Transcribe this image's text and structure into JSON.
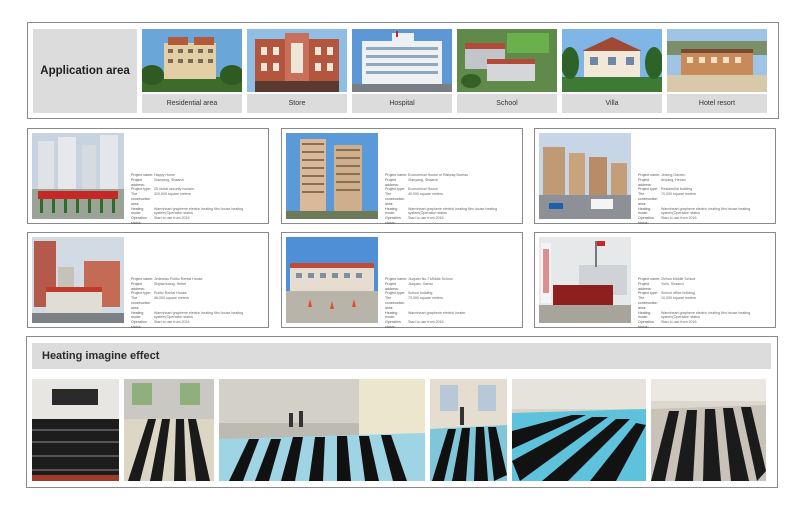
{
  "application": {
    "title": "Application area",
    "areas": [
      {
        "label": "Residential area",
        "icon": "residential-photo"
      },
      {
        "label": "Store",
        "icon": "store-photo"
      },
      {
        "label": "Hospital",
        "icon": "hospital-photo"
      },
      {
        "label": "School",
        "icon": "school-photo"
      },
      {
        "label": "Villa",
        "icon": "villa-photo"
      },
      {
        "label": "Hotel resort",
        "icon": "hotel-resort-photo"
      }
    ]
  },
  "projects": [
    {
      "rows": [
        {
          "k": "Project name:",
          "v": "Happy Home"
        },
        {
          "k": "Project address:",
          "v": "Xianyang, Shaanxi"
        },
        {
          "k": "Project type:",
          "v": "25 rental security houses"
        },
        {
          "k": "The construction area:",
          "v": "320,000 square meters"
        },
        {
          "k": "Heating mode:",
          "v": "Warmheart graphene electric heating film house heating system(Operation status"
        },
        {
          "k": "Operation status:",
          "v": "Start to use from 2015"
        }
      ]
    },
    {
      "rows": [
        {
          "k": "Project name:",
          "v": "Economical House of Railway Bureau"
        },
        {
          "k": "Project address:",
          "v": "Xianyang, Shaanxi"
        },
        {
          "k": "Project type:",
          "v": "Economical House"
        },
        {
          "k": "The construction area:",
          "v": "40,000 square meters"
        },
        {
          "k": "Heating mode:",
          "v": "Warmheart graphene electric heating film house heating system(Operation status"
        },
        {
          "k": "Operation status:",
          "v": "Start to use from 2016"
        }
      ]
    },
    {
      "rows": [
        {
          "k": "Project name:",
          "v": "Jinlong Garden"
        },
        {
          "k": "Project address:",
          "v": "Anyang, Henan"
        },
        {
          "k": "Project type:",
          "v": "Residential building"
        },
        {
          "k": "The construction area:",
          "v": "70,000 square meters"
        },
        {
          "k": "Heating mode:",
          "v": "Warmheart graphene electric heating film house heating system(Operation status"
        },
        {
          "k": "Operation status:",
          "v": "Start to use from 2016"
        }
      ]
    },
    {
      "rows": [
        {
          "k": "Project name:",
          "v": "Jinfeixiao Public Rental House"
        },
        {
          "k": "Project address:",
          "v": "Shijiazhuang, Hebei"
        },
        {
          "k": "Project type:",
          "v": "Public Rental House"
        },
        {
          "k": "The construction area:",
          "v": "46,000 square meters"
        },
        {
          "k": "Heating mode:",
          "v": "Warmheart graphene electric heating film house heating system(Operation status"
        },
        {
          "k": "Operation status:",
          "v": "Start to use from 2014"
        }
      ]
    },
    {
      "rows": [
        {
          "k": "Project name:",
          "v": "Jiuquan No.7 Middle School"
        },
        {
          "k": "Project address:",
          "v": "Jiuquan, Gansu"
        },
        {
          "k": "Project type:",
          "v": "School building"
        },
        {
          "k": "The construction area:",
          "v": "70,000 square meters"
        },
        {
          "k": "Heating mode:",
          "v": "Warmheart graphene electric heater"
        },
        {
          "k": "Operation status:",
          "v": "Start to use from 2016"
        }
      ]
    },
    {
      "rows": [
        {
          "k": "Project name:",
          "v": "Zizhou Middle School"
        },
        {
          "k": "Project address:",
          "v": "Yulin, Shaanxi"
        },
        {
          "k": "Project type:",
          "v": "School office building"
        },
        {
          "k": "The construction area:",
          "v": "10,000 square meters"
        },
        {
          "k": "Heating mode:",
          "v": "Warmheart graphene electric heating film house heating system(Operation status"
        },
        {
          "k": "Operation status:",
          "v": "Start to use from 2016"
        }
      ]
    }
  ],
  "heating": {
    "title": "Heating imagine effect",
    "photos": [
      "heating-film-photo-1",
      "heating-film-photo-2",
      "heating-film-photo-3",
      "heating-film-photo-4",
      "heating-film-photo-5",
      "heating-film-photo-6"
    ]
  },
  "colors": {
    "panel_border": "#8a8a8a",
    "label_bg": "#dcdcdc"
  }
}
